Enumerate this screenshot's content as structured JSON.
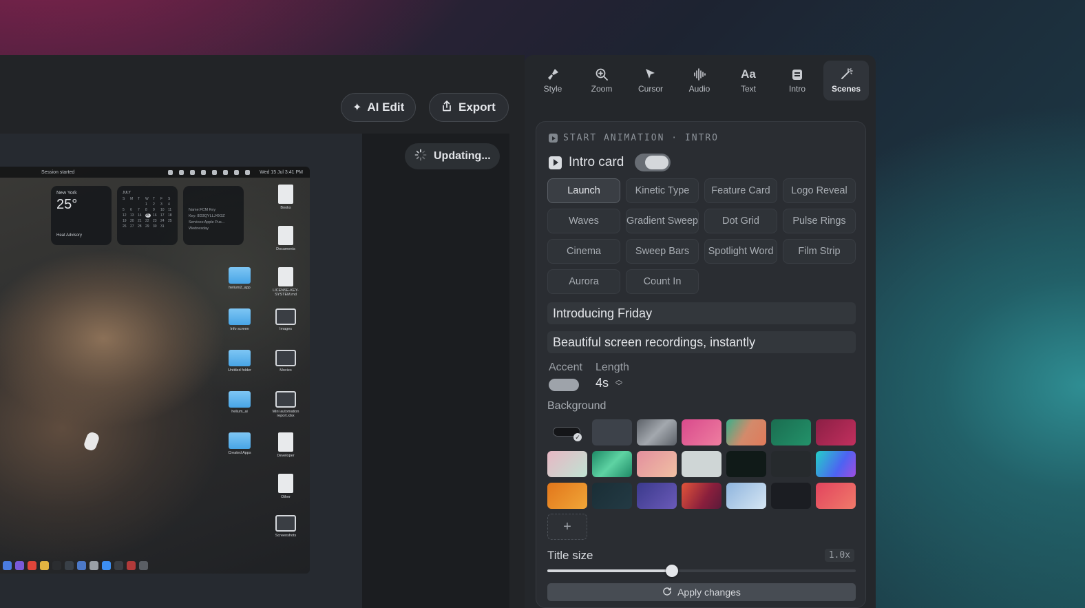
{
  "header": {
    "ai_edit_label": "AI Edit",
    "export_label": "Export",
    "updating_label": "Updating..."
  },
  "screenshot": {
    "menubar_left": "Session started",
    "menubar_right": "Wed 15 Jul  3:41 PM",
    "weather": {
      "city": "New York",
      "temp": "25°",
      "note": "Heat Advisory"
    },
    "calendar_month": "JULY",
    "note_widget": [
      "Name:FCM Key",
      "Key: 8D3QYLLJ4X3Z",
      "Services:Apple Pus...",
      "Wednesday"
    ],
    "desktop_icons": [
      {
        "label": "Books",
        "type": "doc"
      },
      {
        "label": "Documents",
        "type": "doc"
      },
      {
        "label": "helium2_app",
        "type": "folder"
      },
      {
        "label": "LICENSE-KEY-SYSTEM.md",
        "type": "doc"
      },
      {
        "label": "Info screen",
        "type": "folder"
      },
      {
        "label": "Images",
        "type": "img"
      },
      {
        "label": "Untitled folder",
        "type": "folder"
      },
      {
        "label": "Movies",
        "type": "img"
      },
      {
        "label": "helium_ai",
        "type": "folder"
      },
      {
        "label": "Mini automation report.xlsx",
        "type": "img"
      },
      {
        "label": "Created Apps",
        "type": "folder"
      },
      {
        "label": "Developer",
        "type": "doc"
      },
      {
        "label": "Other",
        "type": "doc"
      },
      {
        "label": "Screenshots",
        "type": "img"
      }
    ]
  },
  "tabs": [
    {
      "label": "Style",
      "icon": "brush-icon"
    },
    {
      "label": "Zoom",
      "icon": "zoom-icon"
    },
    {
      "label": "Cursor",
      "icon": "cursor-icon"
    },
    {
      "label": "Audio",
      "icon": "waveform-icon"
    },
    {
      "label": "Text",
      "icon": "text-icon"
    },
    {
      "label": "Intro",
      "icon": "intro-icon"
    },
    {
      "label": "Scenes",
      "icon": "scenes-icon"
    }
  ],
  "active_tab": "Scenes",
  "section_title": "START ANIMATION · INTRO",
  "intro_card_label": "Intro card",
  "intro_card_enabled": true,
  "presets": [
    "Launch",
    "Kinetic Type",
    "Feature Card",
    "Logo Reveal",
    "Waves",
    "Gradient Sweep",
    "Dot Grid",
    "Pulse Rings",
    "Cinema",
    "Sweep Bars",
    "Spotlight Word",
    "Film Strip",
    "Aurora",
    "Count In"
  ],
  "selected_preset": "Launch",
  "title_value": "Introducing Friday",
  "subtitle_value": "Beautiful screen recordings, instantly",
  "accent_label": "Accent",
  "length_label": "Length",
  "length_value": "4s",
  "background_label": "Background",
  "backgrounds": [
    "#2a2c30",
    "#3d424a",
    "#8b9097",
    "#e0548a",
    "#c98a6a",
    "#1f7a5a",
    "#a0254d",
    "#d7c6c1",
    "#2aa27b",
    "#e3a39c",
    "#cfd6d6",
    "#101a18",
    "#262a2d",
    "#3d8ef0",
    "#e88a1e",
    "#1c2a32",
    "#4a4a9e",
    "#c84a3a",
    "#a6c2e2",
    "#1b1d22",
    "#e85568"
  ],
  "title_size_label": "Title size",
  "title_size_value": "1.0x",
  "title_size_fraction": 0.405,
  "apply_label": "Apply changes"
}
